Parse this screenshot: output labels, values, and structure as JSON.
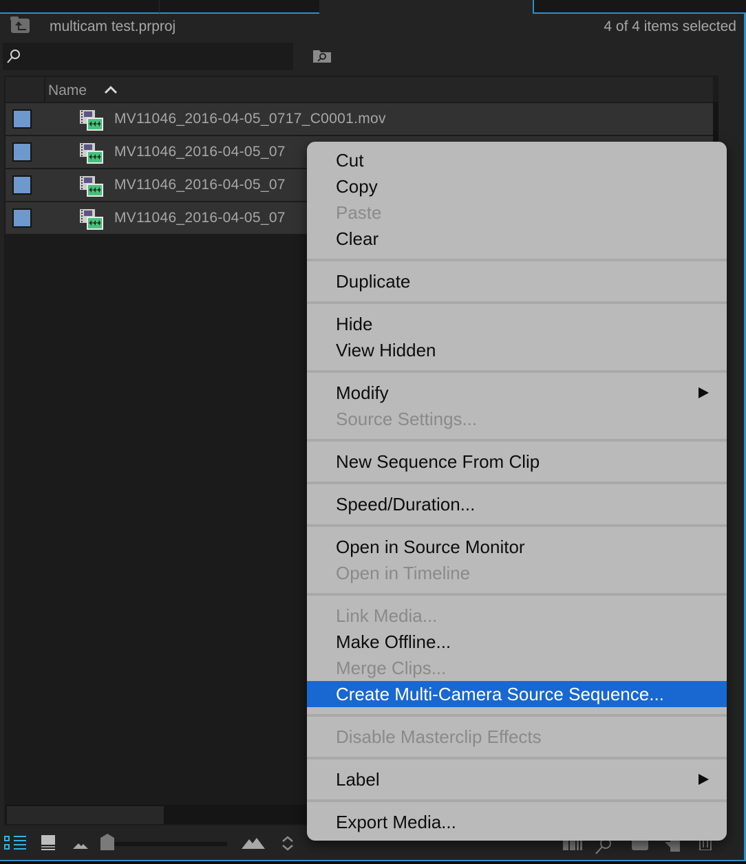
{
  "tabs": [
    {
      "label": "",
      "active": false
    },
    {
      "label": "",
      "active": false
    },
    {
      "label": "",
      "active": true
    },
    {
      "label": "",
      "active": false
    }
  ],
  "project": {
    "title": "multicam test.prproj",
    "selection_status": "4 of 4 items selected"
  },
  "search": {
    "value": "",
    "placeholder": ""
  },
  "list": {
    "column_header": "Name",
    "sort_direction": "ascending",
    "label_color": "#6f99cc",
    "rows": [
      {
        "name": "MV11046_2016-04-05_0717_C0001.mov",
        "selected": true
      },
      {
        "name": "MV11046_2016-04-05_07",
        "selected": true
      },
      {
        "name": "MV11046_2016-04-05_07",
        "selected": true
      },
      {
        "name": "MV11046_2016-04-05_07",
        "selected": true
      }
    ]
  },
  "toolbar": {
    "zoom_slider_value": 0,
    "icons": [
      "list-view-icon",
      "icon-view-icon",
      "small-thumbnail-icon",
      "zoom-slider",
      "large-thumbnail-icon",
      "sort-icon",
      "automate-to-sequence-icon",
      "find-icon",
      "new-bin-icon",
      "new-item-icon",
      "clear-icon"
    ]
  },
  "context_menu": {
    "highlight_color": "#1967d1",
    "groups": [
      [
        {
          "label": "Cut",
          "enabled": true
        },
        {
          "label": "Copy",
          "enabled": true
        },
        {
          "label": "Paste",
          "enabled": false
        },
        {
          "label": "Clear",
          "enabled": true
        }
      ],
      [
        {
          "label": "Duplicate",
          "enabled": true
        }
      ],
      [
        {
          "label": "Hide",
          "enabled": true
        },
        {
          "label": "View Hidden",
          "enabled": true
        }
      ],
      [
        {
          "label": "Modify",
          "enabled": true,
          "submenu": true
        },
        {
          "label": "Source Settings...",
          "enabled": false
        }
      ],
      [
        {
          "label": "New Sequence From Clip",
          "enabled": true
        }
      ],
      [
        {
          "label": "Speed/Duration...",
          "enabled": true
        }
      ],
      [
        {
          "label": "Open in Source Monitor",
          "enabled": true
        },
        {
          "label": "Open in Timeline",
          "enabled": false
        }
      ],
      [
        {
          "label": "Link Media...",
          "enabled": false
        },
        {
          "label": "Make Offline...",
          "enabled": true
        },
        {
          "label": "Merge Clips...",
          "enabled": false
        },
        {
          "label": "Create Multi-Camera Source Sequence...",
          "enabled": true,
          "highlighted": true
        }
      ],
      [
        {
          "label": "Disable Masterclip Effects",
          "enabled": false
        }
      ],
      [
        {
          "label": "Label",
          "enabled": true,
          "submenu": true
        }
      ],
      [
        {
          "label": "Export Media...",
          "enabled": true
        }
      ]
    ]
  }
}
